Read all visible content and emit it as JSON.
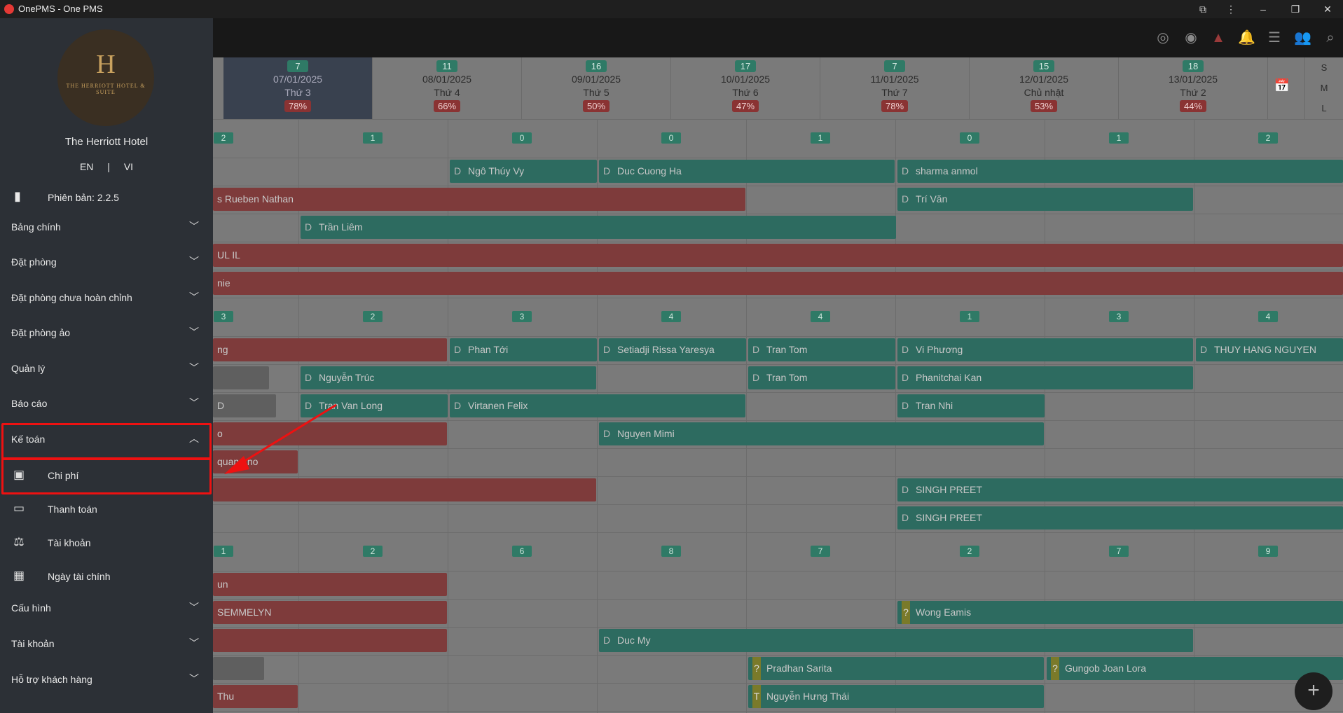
{
  "window": {
    "title": "OnePMS - One PMS"
  },
  "dates": [
    {
      "count": "7",
      "date": "07/01/2025",
      "weekday": "Thứ 3",
      "pct": "78%"
    },
    {
      "count": "11",
      "date": "08/01/2025",
      "weekday": "Thứ 4",
      "pct": "66%"
    },
    {
      "count": "16",
      "date": "09/01/2025",
      "weekday": "Thứ 5",
      "pct": "50%"
    },
    {
      "count": "17",
      "date": "10/01/2025",
      "weekday": "Thứ 6",
      "pct": "47%"
    },
    {
      "count": "7",
      "date": "11/01/2025",
      "weekday": "Thứ 7",
      "pct": "78%"
    },
    {
      "count": "15",
      "date": "12/01/2025",
      "weekday": "Chủ nhật",
      "pct": "53%"
    },
    {
      "count": "18",
      "date": "13/01/2025",
      "weekday": "Thứ 2",
      "pct": "44%"
    }
  ],
  "size_toggle": [
    "S",
    "M",
    "L"
  ],
  "summary_rows": [
    [
      "2",
      "1",
      "0",
      "0",
      "1",
      "0",
      "1",
      "2"
    ],
    [
      "3",
      "2",
      "3",
      "4",
      "4",
      "1",
      "3",
      "4"
    ],
    [
      "1",
      "2",
      "6",
      "8",
      "7",
      "2",
      "7",
      "9"
    ]
  ],
  "bookings": [
    {
      "tag": "D",
      "name": "Ngô Thúy Vy",
      "color": "teal"
    },
    {
      "tag": "D",
      "name": "Duc Cuong Ha",
      "color": "teal"
    },
    {
      "tag": "D",
      "name": "sharma anmol",
      "color": "teal"
    },
    {
      "tag": "",
      "name": "s Rueben Nathan",
      "color": "red"
    },
    {
      "tag": "D",
      "name": "Trí Văn",
      "color": "teal"
    },
    {
      "tag": "D",
      "name": "Trần Liêm",
      "color": "teal"
    },
    {
      "tag": "",
      "name": "UL IL",
      "color": "red"
    },
    {
      "tag": "",
      "name": "nie",
      "color": "red"
    },
    {
      "tag": "",
      "name": "ng",
      "color": "red"
    },
    {
      "tag": "D",
      "name": "Phan Tới",
      "color": "teal"
    },
    {
      "tag": "D",
      "name": "Setiadji Rissa Yaresya",
      "color": "teal"
    },
    {
      "tag": "D",
      "name": "Tran Tom",
      "color": "teal"
    },
    {
      "tag": "D",
      "name": "Vi Phương",
      "color": "teal"
    },
    {
      "tag": "D",
      "name": "THUY HANG NGUYEN",
      "color": "teal"
    },
    {
      "tag": "",
      "name": "",
      "color": "grey"
    },
    {
      "tag": "D",
      "name": "Nguyễn Trúc",
      "color": "teal"
    },
    {
      "tag": "D",
      "name": "Tran Tom",
      "color": "teal"
    },
    {
      "tag": "D",
      "name": "Phanitchai Kan",
      "color": "teal"
    },
    {
      "tag": "",
      "name": "D",
      "color": "grey"
    },
    {
      "tag": "D",
      "name": "Tran Van Long",
      "color": "teal"
    },
    {
      "tag": "D",
      "name": "Virtanen Felix",
      "color": "teal"
    },
    {
      "tag": "D",
      "name": "Tran Nhi",
      "color": "teal"
    },
    {
      "tag": "",
      "name": "o",
      "color": "red"
    },
    {
      "tag": "D",
      "name": "Nguyen Mimi",
      "color": "teal"
    },
    {
      "tag": "",
      "name": "quang ho",
      "color": "red"
    },
    {
      "tag": "",
      "name": "",
      "color": "red"
    },
    {
      "tag": "D",
      "name": "SINGH PREET",
      "color": "teal"
    },
    {
      "tag": "D",
      "name": "SINGH PREET",
      "color": "teal"
    },
    {
      "tag": "",
      "name": "un",
      "color": "red"
    },
    {
      "tag": "",
      "name": "SEMMELYN",
      "color": "red"
    },
    {
      "tag": "?",
      "name": "Wong Eamis",
      "color": "teal"
    },
    {
      "tag": "",
      "name": "",
      "color": "red"
    },
    {
      "tag": "D",
      "name": "Duc My",
      "color": "teal"
    },
    {
      "tag": "",
      "name": "",
      "color": "grey"
    },
    {
      "tag": "?",
      "name": "Pradhan Sarita",
      "color": "teal"
    },
    {
      "tag": "?",
      "name": "Gungob Joan Lora",
      "color": "teal"
    },
    {
      "tag": "",
      "name": "Thu",
      "color": "red"
    },
    {
      "tag": "T",
      "name": "Nguyễn Hưng Thái",
      "color": "teal"
    }
  ],
  "sidebar": {
    "logo_letter": "H",
    "logo_text": "THE HERRIOTT HOTEL & SUITE",
    "hotel_name": "The Herriott Hotel",
    "lang": "EN | VI",
    "version": "Phiên bản: 2.2.5",
    "menu": [
      "Bảng chính",
      "Đặt phòng",
      "Đặt phòng chưa hoàn chỉnh",
      "Đặt phòng ảo",
      "Quản lý",
      "Báo cáo",
      "Kế toán",
      "Cấu hình",
      "Tài khoản",
      "Hỗ trợ khách hàng"
    ],
    "accounting_sub": [
      "Chi phí",
      "Thanh toán",
      "Tài khoản",
      "Ngày tài chính"
    ]
  },
  "fab": "+"
}
